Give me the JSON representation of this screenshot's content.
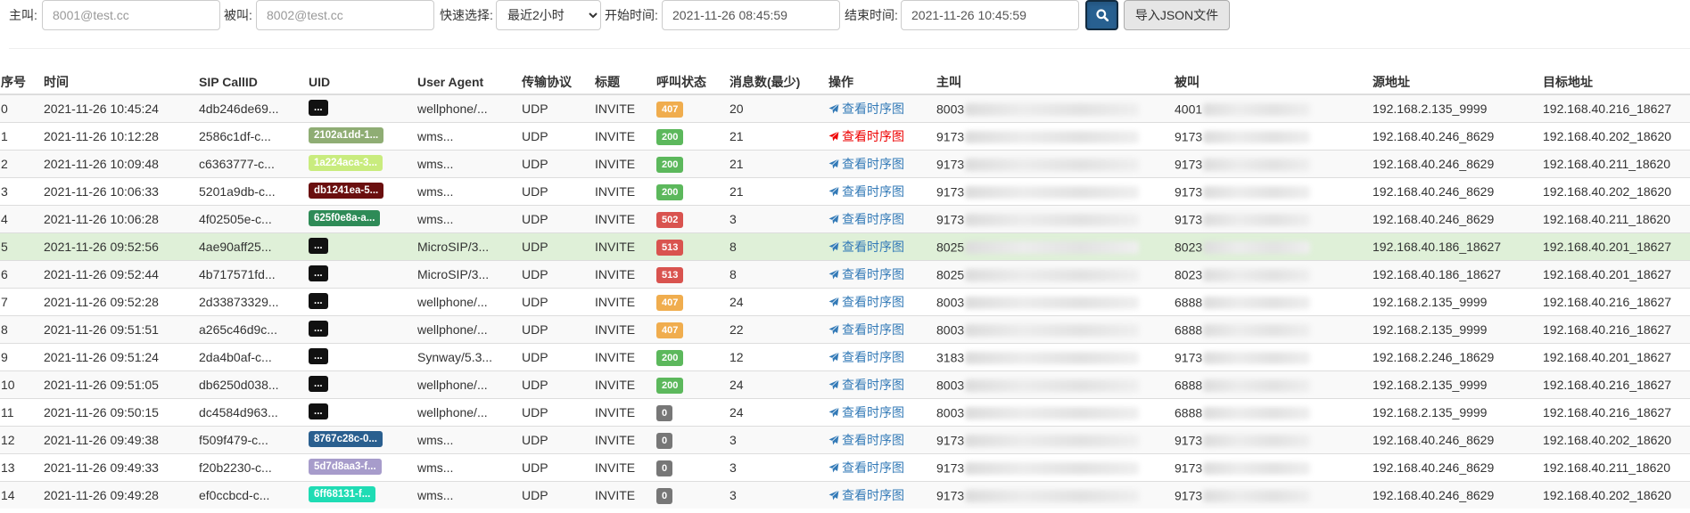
{
  "filters": {
    "caller_label": "主叫:",
    "caller_placeholder": "8001@test.cc",
    "callee_label": "被叫:",
    "callee_placeholder": "8002@test.cc",
    "quick_label": "快速选择:",
    "quick_value": "最近2小时",
    "start_label": "开始时间:",
    "start_value": "2021-11-26 08:45:59",
    "end_label": "结束时间:",
    "end_value": "2021-11-26 10:45:59",
    "search_icon": "search-icon",
    "import_label": "导入JSON文件"
  },
  "table": {
    "headers": [
      "序号",
      "时间",
      "SIP CallID",
      "UID",
      "User Agent",
      "传输协议",
      "标题",
      "呼叫状态",
      "消息数(最少)",
      "操作",
      "主叫",
      "被叫",
      "源地址",
      "目标地址"
    ],
    "link_text": "查看时序图",
    "rows": [
      {
        "seq": "0",
        "time": "2021-11-26 10:45:24",
        "callid": "4db246de69...",
        "uid": "...",
        "uid_color": "#111111",
        "ua": "wellphone/...",
        "proto": "UDP",
        "title": "INVITE",
        "status": "407",
        "status_color": "#f0ad4e",
        "msgs": "20",
        "link_red": false,
        "caller": "8003",
        "callee": "4001",
        "src": "192.168.2.135_9999",
        "dst": "192.168.40.216_18627"
      },
      {
        "seq": "1",
        "time": "2021-11-26 10:12:28",
        "callid": "2586c1df-c...",
        "uid": "2102a1dd-1...",
        "uid_color": "#8fad74",
        "ua": "wms...",
        "proto": "UDP",
        "title": "INVITE",
        "status": "200",
        "status_color": "#5cb85c",
        "msgs": "21",
        "link_red": true,
        "caller": "9173",
        "callee": "9173",
        "src": "192.168.40.246_8629",
        "dst": "192.168.40.202_18620"
      },
      {
        "seq": "2",
        "time": "2021-11-26 10:09:48",
        "callid": "c6363777-c...",
        "uid": "1a224aca-3...",
        "uid_color": "#c9ec7e",
        "ua": "wms...",
        "proto": "UDP",
        "title": "INVITE",
        "status": "200",
        "status_color": "#5cb85c",
        "msgs": "21",
        "link_red": false,
        "caller": "9173",
        "callee": "9173",
        "src": "192.168.40.246_8629",
        "dst": "192.168.40.211_18620"
      },
      {
        "seq": "3",
        "time": "2021-11-26 10:06:33",
        "callid": "5201a9db-c...",
        "uid": "db1241ea-5...",
        "uid_color": "#6a0f0f",
        "ua": "wms...",
        "proto": "UDP",
        "title": "INVITE",
        "status": "200",
        "status_color": "#5cb85c",
        "msgs": "21",
        "link_red": false,
        "caller": "9173",
        "callee": "9173",
        "src": "192.168.40.246_8629",
        "dst": "192.168.40.202_18620"
      },
      {
        "seq": "4",
        "time": "2021-11-26 10:06:28",
        "callid": "4f02505e-c...",
        "uid": "625f0e8a-a...",
        "uid_color": "#2e8b57",
        "ua": "wms...",
        "proto": "UDP",
        "title": "INVITE",
        "status": "502",
        "status_color": "#d9534f",
        "msgs": "3",
        "link_red": false,
        "caller": "9173",
        "callee": "9173",
        "src": "192.168.40.246_8629",
        "dst": "192.168.40.211_18620"
      },
      {
        "seq": "5",
        "time": "2021-11-26 09:52:56",
        "callid": "4ae90aff25...",
        "uid": "...",
        "uid_color": "#111111",
        "ua": "MicroSIP/3...",
        "proto": "UDP",
        "title": "INVITE",
        "status": "513",
        "status_color": "#d9534f",
        "msgs": "8",
        "link_red": false,
        "caller": "8025",
        "callee": "8023",
        "src": "192.168.40.186_18627",
        "dst": "192.168.40.201_18627"
      },
      {
        "seq": "6",
        "time": "2021-11-26 09:52:44",
        "callid": "4b717571fd...",
        "uid": "...",
        "uid_color": "#111111",
        "ua": "MicroSIP/3...",
        "proto": "UDP",
        "title": "INVITE",
        "status": "513",
        "status_color": "#d9534f",
        "msgs": "8",
        "link_red": false,
        "caller": "8025",
        "callee": "8023",
        "src": "192.168.40.186_18627",
        "dst": "192.168.40.201_18627"
      },
      {
        "seq": "7",
        "time": "2021-11-26 09:52:28",
        "callid": "2d33873329...",
        "uid": "...",
        "uid_color": "#111111",
        "ua": "wellphone/...",
        "proto": "UDP",
        "title": "INVITE",
        "status": "407",
        "status_color": "#f0ad4e",
        "msgs": "24",
        "link_red": false,
        "caller": "8003",
        "callee": "6888",
        "src": "192.168.2.135_9999",
        "dst": "192.168.40.216_18627"
      },
      {
        "seq": "8",
        "time": "2021-11-26 09:51:51",
        "callid": "a265c46d9c...",
        "uid": "...",
        "uid_color": "#111111",
        "ua": "wellphone/...",
        "proto": "UDP",
        "title": "INVITE",
        "status": "407",
        "status_color": "#f0ad4e",
        "msgs": "22",
        "link_red": false,
        "caller": "8003",
        "callee": "6888",
        "src": "192.168.2.135_9999",
        "dst": "192.168.40.216_18627"
      },
      {
        "seq": "9",
        "time": "2021-11-26 09:51:24",
        "callid": "2da4b0af-c...",
        "uid": "...",
        "uid_color": "#111111",
        "ua": "Synway/5.3...",
        "proto": "UDP",
        "title": "INVITE",
        "status": "200",
        "status_color": "#5cb85c",
        "msgs": "12",
        "link_red": false,
        "caller": "3183",
        "callee": "9173",
        "src": "192.168.2.246_18629",
        "dst": "192.168.40.201_18627"
      },
      {
        "seq": "10",
        "time": "2021-11-26 09:51:05",
        "callid": "db6250d038...",
        "uid": "...",
        "uid_color": "#111111",
        "ua": "wellphone/...",
        "proto": "UDP",
        "title": "INVITE",
        "status": "200",
        "status_color": "#5cb85c",
        "msgs": "24",
        "link_red": false,
        "caller": "8003",
        "callee": "6888",
        "src": "192.168.2.135_9999",
        "dst": "192.168.40.216_18627"
      },
      {
        "seq": "11",
        "time": "2021-11-26 09:50:15",
        "callid": "dc4584d963...",
        "uid": "...",
        "uid_color": "#111111",
        "ua": "wellphone/...",
        "proto": "UDP",
        "title": "INVITE",
        "status": "0",
        "status_color": "#777777",
        "msgs": "24",
        "link_red": false,
        "caller": "8003",
        "callee": "6888",
        "src": "192.168.2.135_9999",
        "dst": "192.168.40.216_18627"
      },
      {
        "seq": "12",
        "time": "2021-11-26 09:49:38",
        "callid": "f509f479-c...",
        "uid": "8767c28c-0...",
        "uid_color": "#2a5f8f",
        "ua": "wms...",
        "proto": "UDP",
        "title": "INVITE",
        "status": "0",
        "status_color": "#777777",
        "msgs": "3",
        "link_red": false,
        "caller": "9173",
        "callee": "9173",
        "src": "192.168.40.246_8629",
        "dst": "192.168.40.202_18620"
      },
      {
        "seq": "13",
        "time": "2021-11-26 09:49:33",
        "callid": "f20b2230-c...",
        "uid": "5d7d8aa3-f...",
        "uid_color": "#a79ccb",
        "ua": "wms...",
        "proto": "UDP",
        "title": "INVITE",
        "status": "0",
        "status_color": "#777777",
        "msgs": "3",
        "link_red": false,
        "caller": "9173",
        "callee": "9173",
        "src": "192.168.40.246_8629",
        "dst": "192.168.40.211_18620"
      },
      {
        "seq": "14",
        "time": "2021-11-26 09:49:28",
        "callid": "ef0ccbcd-c...",
        "uid": "6ff68131-f...",
        "uid_color": "#1fdcb4",
        "ua": "wms...",
        "proto": "UDP",
        "title": "INVITE",
        "status": "0",
        "status_color": "#777777",
        "msgs": "3",
        "link_red": false,
        "caller": "9173",
        "callee": "9173",
        "src": "192.168.40.246_8629",
        "dst": "192.168.40.202_18620"
      }
    ],
    "highlight_row": "5"
  }
}
